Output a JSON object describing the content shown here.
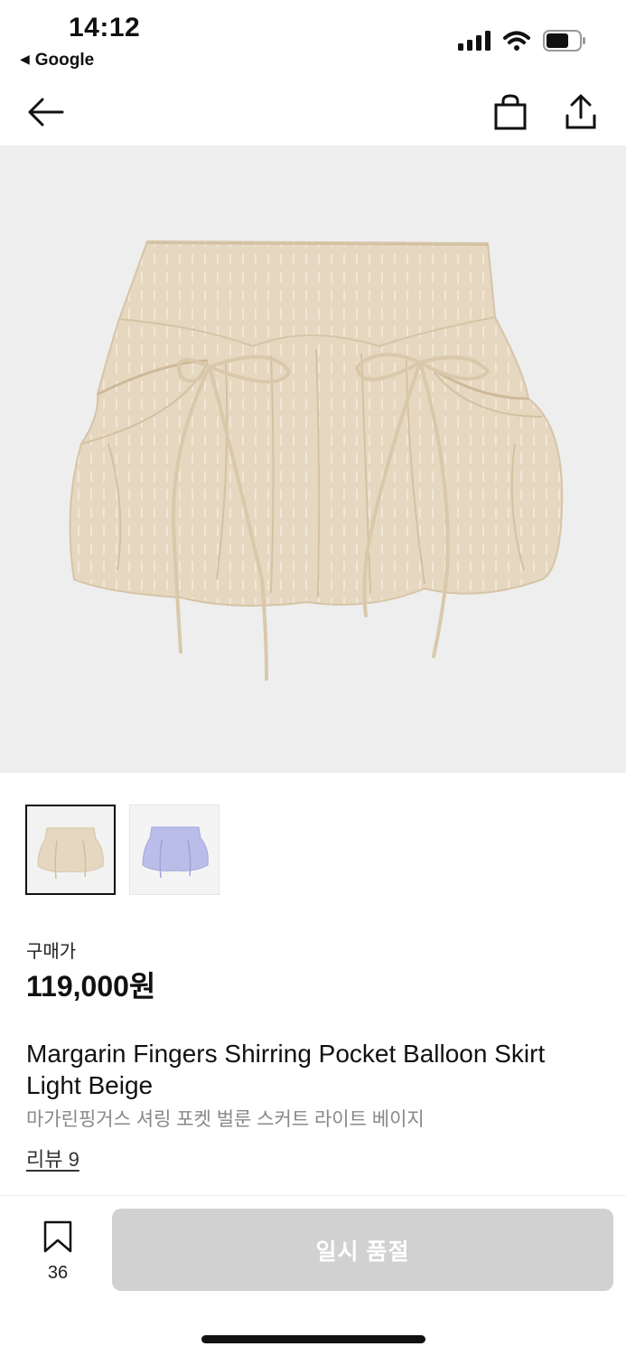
{
  "status_bar": {
    "time": "14:12",
    "back_app": "Google",
    "icons": [
      "signal-icon",
      "wifi-icon",
      "battery-icon"
    ]
  },
  "nav": {
    "back_icon": "arrow-left-icon",
    "cart_icon": "shopping-bag-icon",
    "share_icon": "share-icon"
  },
  "product": {
    "price_label": "구매가",
    "price": "119,000원",
    "title_en": "Margarin Fingers Shirring Pocket Balloon Skirt Light Beige",
    "title_ko": "마가린핑거스 셔링 포켓 벌룬 스커트 라이트 베이지",
    "review_link": "리뷰 9",
    "colors": {
      "beige": "#e6d8c0",
      "lavender": "#b9bde8"
    }
  },
  "thumbnails": [
    {
      "color": "light-beige",
      "selected": true
    },
    {
      "color": "lavender",
      "selected": false
    }
  ],
  "bottom_bar": {
    "bookmark_count": "36",
    "action_label": "일시 품절"
  }
}
